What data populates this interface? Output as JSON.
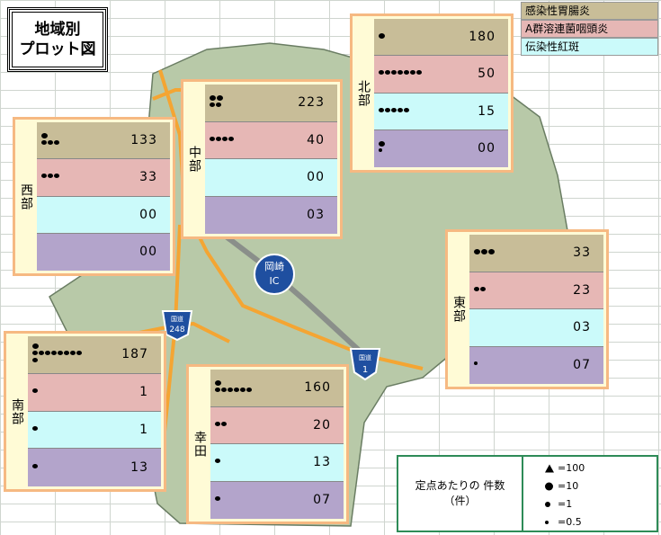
{
  "title": {
    "line1": "地域別",
    "line2": "プロット図"
  },
  "legend": [
    {
      "label": "感染性胃腸炎",
      "color": "#c8bd98"
    },
    {
      "label": "A群溶連菌咽頭炎",
      "color": "#e6b7b5"
    },
    {
      "label": "伝染性紅斑",
      "color": "#cbfafa"
    }
  ],
  "map_labels": {
    "okazaki_ic": {
      "line1": "岡崎",
      "line2": "IC"
    },
    "route248": {
      "top": "国道",
      "num": "248"
    },
    "route1": {
      "top": "国道",
      "num": "1"
    }
  },
  "regions": [
    {
      "name": "北部",
      "values": [
        "180",
        "50",
        "15",
        "00"
      ],
      "dots": [
        [
          1,
          0,
          0
        ],
        [
          0,
          7,
          0
        ],
        [
          0,
          5,
          0
        ],
        [
          0,
          1,
          1
        ]
      ]
    },
    {
      "name": "中部",
      "values": [
        "223",
        "40",
        "00",
        "03"
      ],
      "dots": [
        [
          2,
          0,
          0
        ],
        [
          0,
          2,
          0
        ],
        [
          0,
          3,
          0
        ],
        [
          0,
          4,
          0
        ]
      ]
    },
    {
      "name": "西部",
      "values": [
        "133",
        "33",
        "00",
        "00"
      ],
      "dots": [
        [
          1,
          0,
          0
        ],
        [
          0,
          3,
          0
        ],
        [
          0,
          3,
          0
        ]
      ]
    },
    {
      "name": "東部",
      "values": [
        "33",
        "23",
        "03",
        "07"
      ],
      "dots": [
        [
          0,
          3,
          0
        ],
        [
          0,
          2,
          0
        ],
        [],
        [
          0,
          0,
          1
        ]
      ]
    },
    {
      "name": "南部",
      "values": [
        "187",
        "1",
        "1",
        "13"
      ],
      "dots": [
        [
          1,
          0,
          0
        ],
        [
          0,
          8,
          0
        ],
        [
          1,
          0,
          0
        ],
        [
          0,
          1,
          0
        ],
        [
          0,
          1,
          0
        ],
        [
          0,
          1,
          0
        ]
      ]
    },
    {
      "name": "幸田",
      "values": [
        "160",
        "20",
        "13",
        "07"
      ],
      "dots": [
        [
          1,
          0,
          0
        ],
        [
          0,
          6,
          0
        ],
        [
          0,
          2,
          0
        ],
        [
          0,
          1,
          0
        ],
        [
          0,
          0,
          1
        ]
      ]
    }
  ],
  "unit_legend": {
    "text1": "定点あたりの 件数",
    "text2": "（件）",
    "items": [
      "=100",
      "=10",
      "=1",
      "=0.5"
    ]
  }
}
